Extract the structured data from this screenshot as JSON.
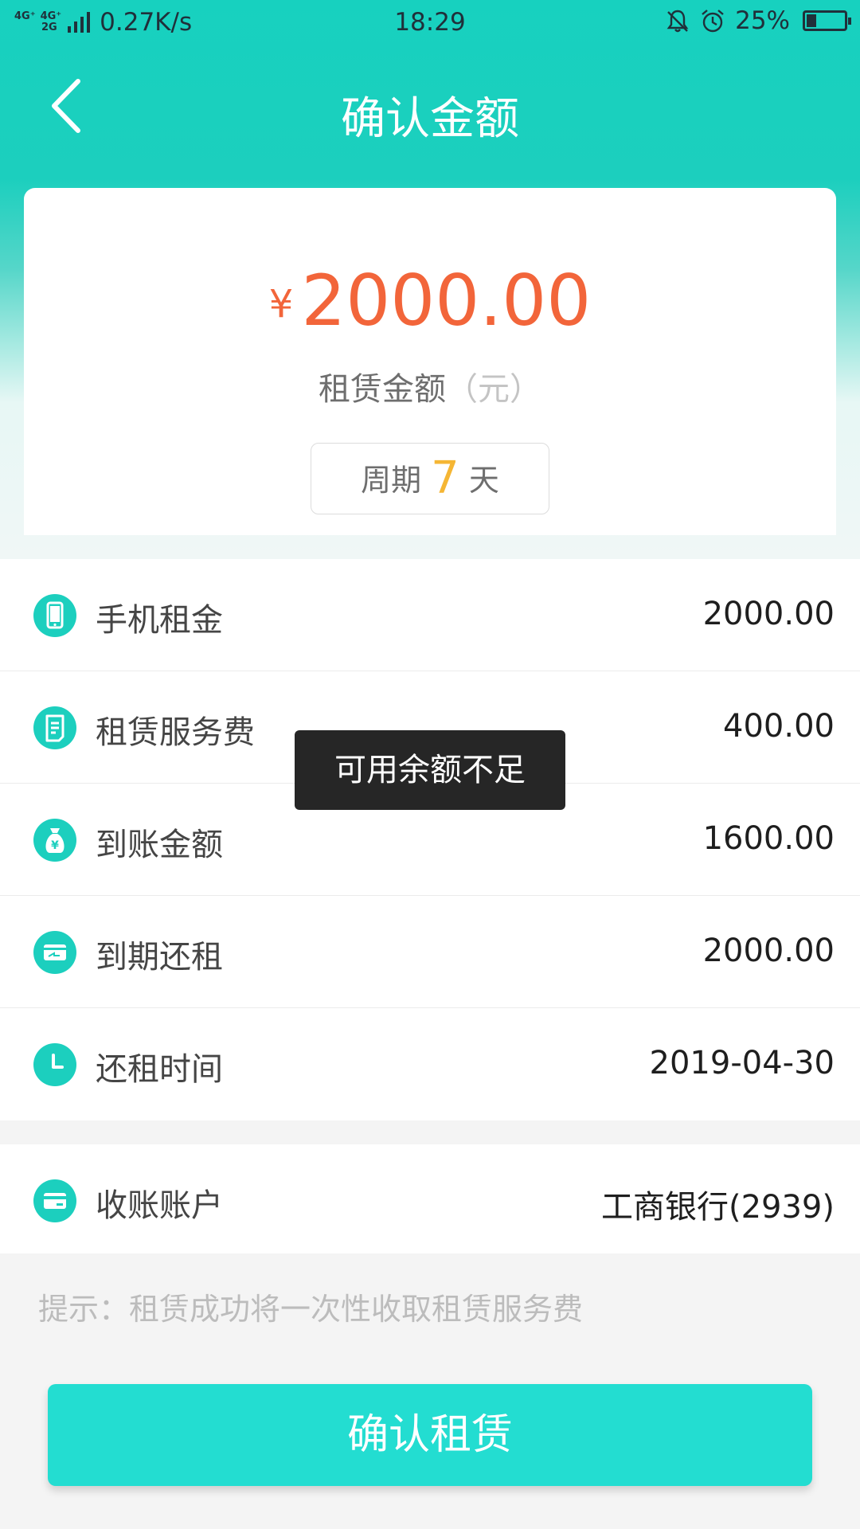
{
  "status_bar": {
    "network_top": [
      "4G⁺",
      "4G⁺"
    ],
    "network_bottom": [
      "",
      "2G"
    ],
    "speed": "0.27K/s",
    "time": "18:29",
    "battery": "25%",
    "battery_level": 0.25
  },
  "nav": {
    "title": "确认金额"
  },
  "amount": {
    "currency": "¥",
    "value": "2000.00",
    "label": "租赁金额",
    "unit": "（元）",
    "period_prefix": "周期",
    "period_days": "7",
    "period_suffix": "天"
  },
  "details": [
    {
      "icon": "phone-icon",
      "label": "手机租金",
      "value": "2000.00"
    },
    {
      "icon": "document-icon",
      "label": "租赁服务费",
      "value": "400.00"
    },
    {
      "icon": "money-bag-icon",
      "label": "到账金额",
      "value": "1600.00"
    },
    {
      "icon": "card-repay-icon",
      "label": "到期还租",
      "value": "2000.00"
    },
    {
      "icon": "clock-icon",
      "label": "还租时间",
      "value": "2019-04-30"
    }
  ],
  "account": {
    "icon": "bank-card-icon",
    "label": "收账账户",
    "value": "工商银行(2939)"
  },
  "tip": "提示：租赁成功将一次性收取租赁服务费",
  "confirm_button": "确认租赁",
  "toast": "可用余额不足",
  "colors": {
    "primary": "#1ccfbe",
    "button": "#23ddd1",
    "amount": "#f2653a",
    "period_days": "#f5b634"
  }
}
